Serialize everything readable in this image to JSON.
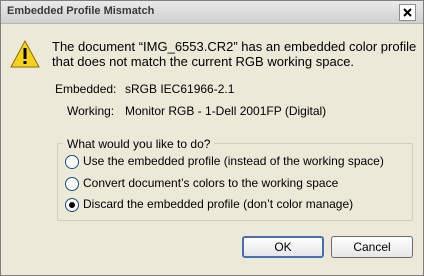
{
  "window": {
    "title": "Embedded Profile Mismatch"
  },
  "message": {
    "line1": "The document “IMG_6553.CR2” has an embedded color profile",
    "line2": "that does not match the current RGB working space."
  },
  "embedded": {
    "label": "Embedded:",
    "value": "sRGB IEC61966-2.1"
  },
  "working": {
    "label": "Working:",
    "value": "Monitor RGB - 1-Dell 2001FP (Digital)"
  },
  "options": {
    "group_title": "What would you like to do?",
    "items": [
      {
        "label": "Use the embedded profile (instead of the working space)",
        "selected": false
      },
      {
        "label": "Convert document’s colors to the working space",
        "selected": false
      },
      {
        "label": "Discard the embedded profile (don’t color manage)",
        "selected": true
      }
    ]
  },
  "buttons": {
    "ok": "OK",
    "cancel": "Cancel"
  },
  "icons": {
    "warning": "warning-icon",
    "close": "close-icon"
  },
  "colors": {
    "warning_fill": "#f7d21c",
    "focus_border": "#4a6fb0"
  }
}
